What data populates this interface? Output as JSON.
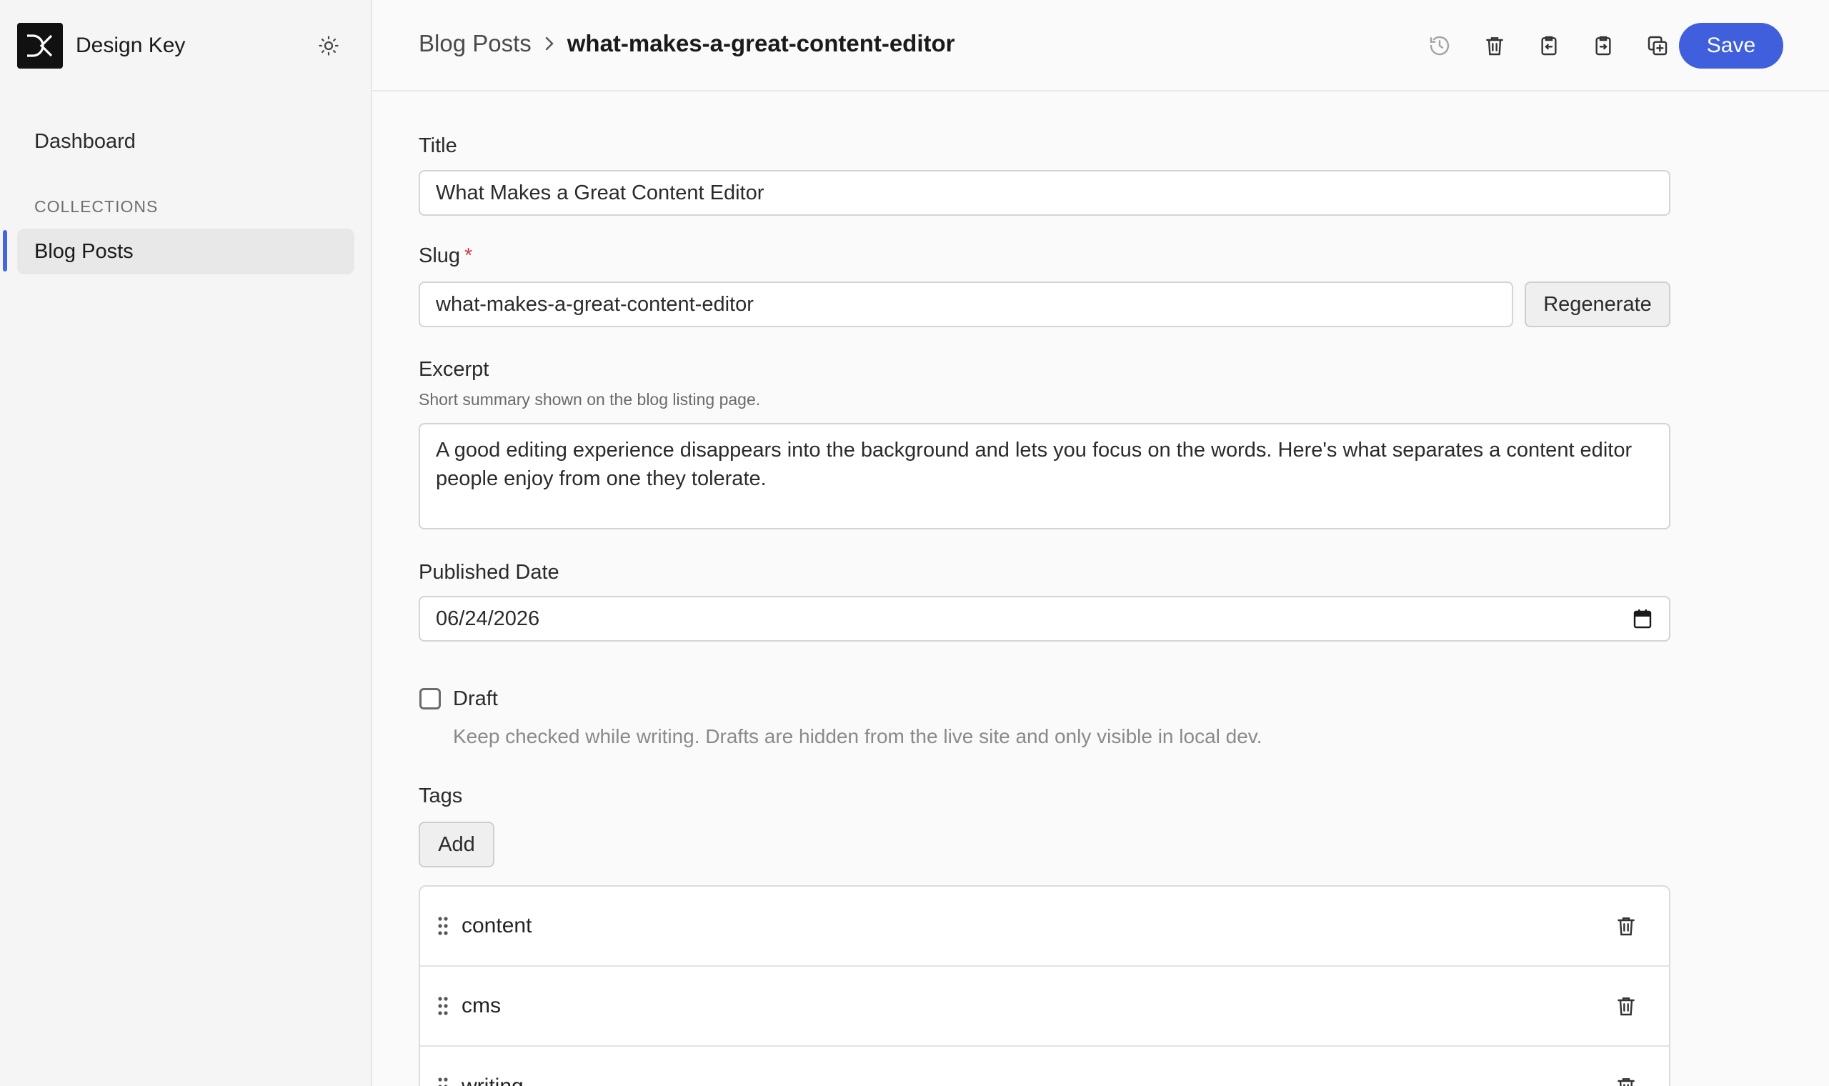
{
  "sidebar": {
    "brand_name": "Design Key",
    "dashboard_label": "Dashboard",
    "section_label": "COLLECTIONS",
    "items": [
      {
        "label": "Blog Posts",
        "active": true
      }
    ]
  },
  "header": {
    "breadcrumb_parent": "Blog Posts",
    "breadcrumb_current": "what-makes-a-great-content-editor",
    "save_label": "Save",
    "tool_icons": [
      "history-icon",
      "trash-icon",
      "clipboard-import-icon",
      "clipboard-export-icon",
      "duplicate-icon"
    ]
  },
  "form": {
    "title": {
      "label": "Title",
      "value": "What Makes a Great Content Editor"
    },
    "slug": {
      "label": "Slug",
      "required_mark": "*",
      "value": "what-makes-a-great-content-editor",
      "regenerate_label": "Regenerate"
    },
    "excerpt": {
      "label": "Excerpt",
      "help": "Short summary shown on the blog listing page.",
      "value": "A good editing experience disappears into the background and lets you focus on the words. Here's what separates a content editor people enjoy from one they tolerate."
    },
    "published_date": {
      "label": "Published Date",
      "value": "06/24/2026"
    },
    "draft": {
      "label": "Draft",
      "checked": false,
      "help": "Keep checked while writing. Drafts are hidden from the live site and only visible in local dev."
    },
    "tags": {
      "label": "Tags",
      "add_label": "Add",
      "items": [
        "content",
        "cms",
        "writing"
      ]
    }
  },
  "colors": {
    "accent": "#3f5fdc",
    "required": "#d23b3b"
  }
}
